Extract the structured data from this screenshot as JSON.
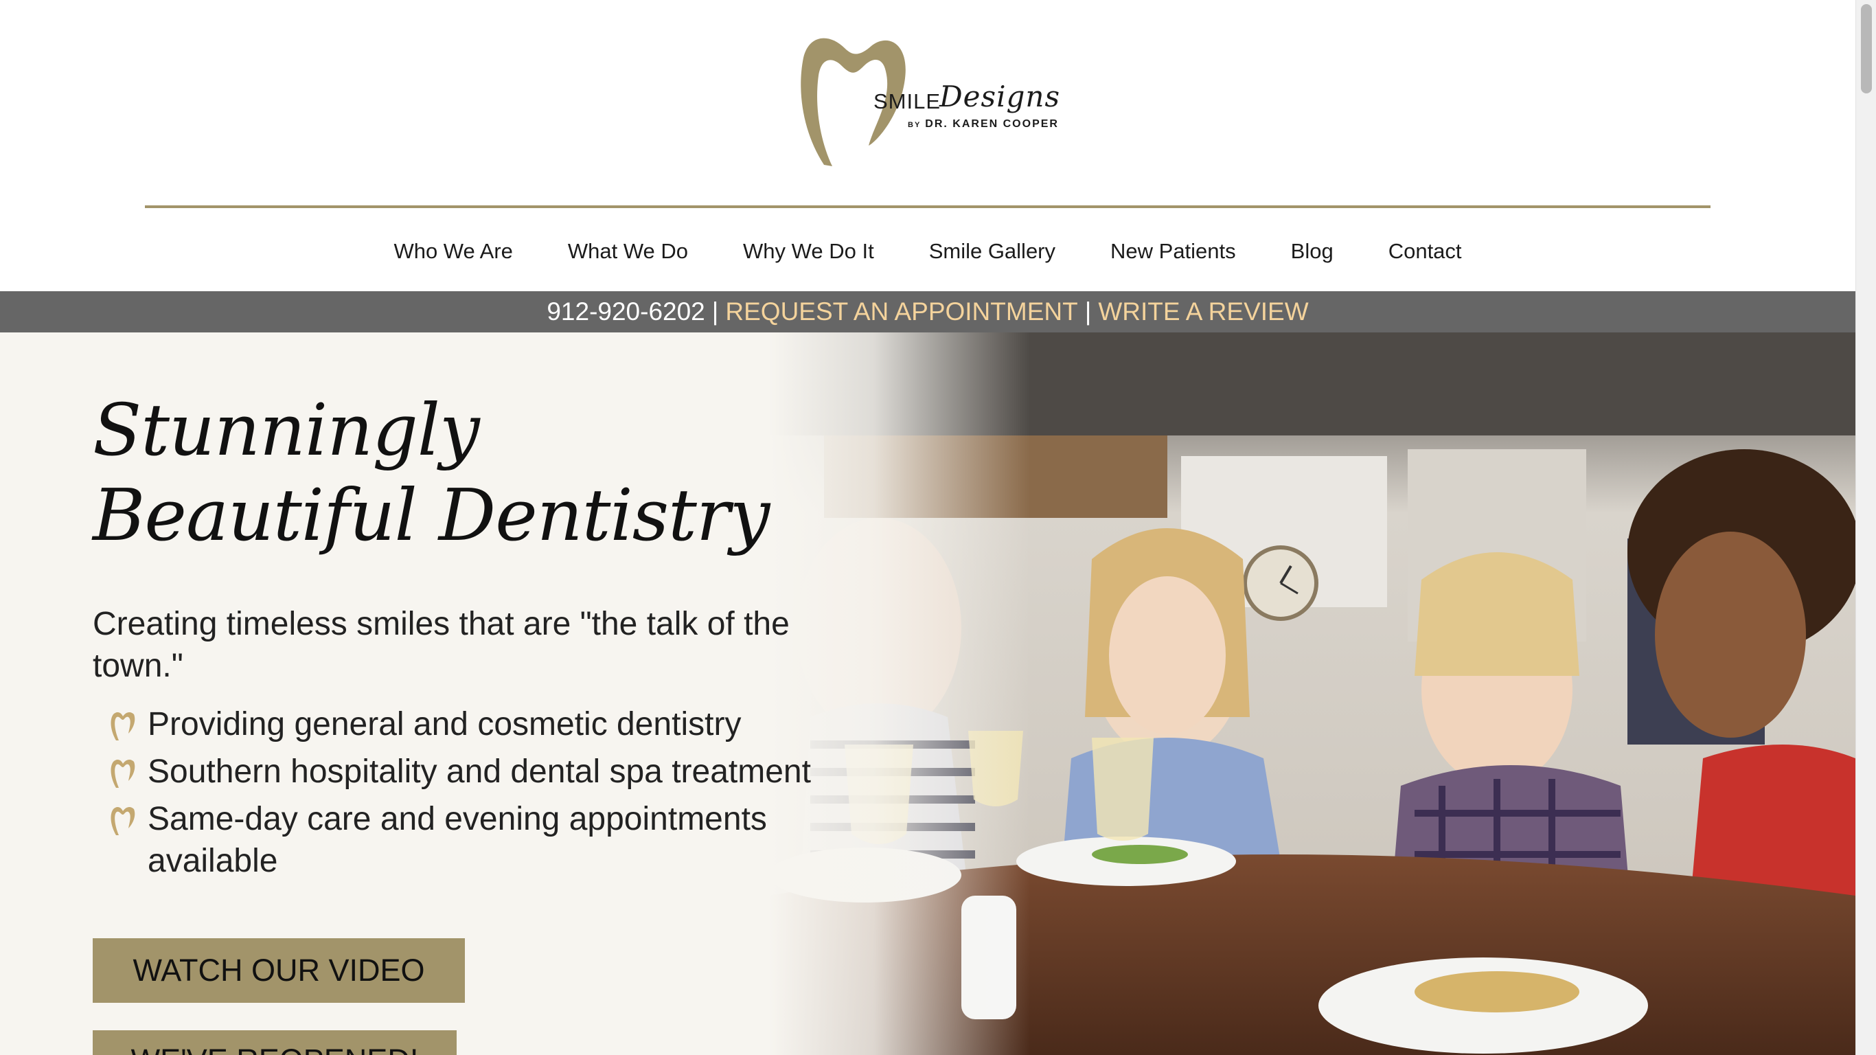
{
  "logo": {
    "word1": "SMILE",
    "word2": "Designs",
    "by_small": "BY",
    "byline": "DR. KAREN COOPER"
  },
  "nav": {
    "items": [
      "Who We Are",
      "What We Do",
      "Why We Do It",
      "Smile Gallery",
      "New Patients",
      "Blog",
      "Contact"
    ]
  },
  "contact_bar": {
    "phone": "912-920-6202",
    "separator": "|",
    "request": "REQUEST AN APPOINTMENT",
    "review": "WRITE A REVIEW"
  },
  "hero": {
    "title": "Stunningly Beautiful Dentistry",
    "subtitle": "Creating timeless smiles that are \"the talk of the town.\"",
    "bullets": [
      "Providing general and cosmetic dentistry",
      "Southern hospitality and dental spa treatment",
      "Same-day care and evening appointments available"
    ],
    "btn_video": "WATCH OUR VIDEO",
    "btn_reopened": "WE'VE REOPENED!"
  },
  "colors": {
    "gold": "#a2946a",
    "contact_bar_bg": "#666666",
    "contact_link": "#f4d39c",
    "hero_bg": "#f7f5f0"
  }
}
